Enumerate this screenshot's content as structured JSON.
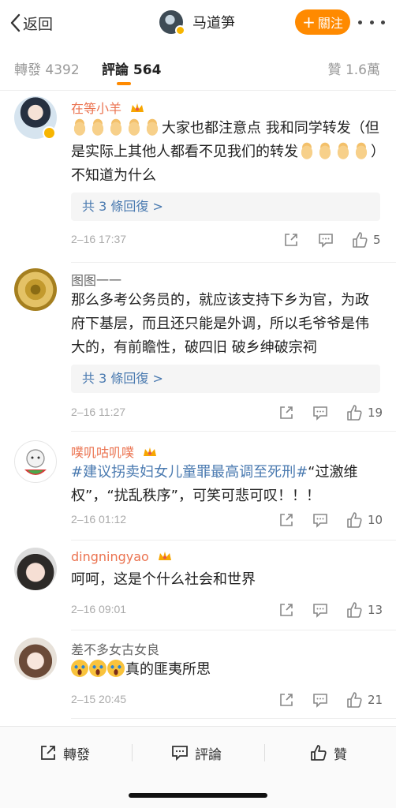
{
  "topbar": {
    "back_label": "返回",
    "author_name": "马道笋",
    "follow_label": "關注",
    "follow_plus": "+"
  },
  "tabs": {
    "repost": "轉發 4392",
    "comments": "評論 564",
    "likes": "贊 1.6萬"
  },
  "comments": [
    {
      "user": "在等小羊",
      "text_parts": [
        "大家也都注意点 我和同学转发（但是实际上其他人都看不见我们的转发",
        "）不知道为什么"
      ],
      "replies": "共 3 條回復 >",
      "time": "2–16 17:37",
      "likes": "5"
    },
    {
      "user": "图图一一",
      "text": "那么多考公务员的，就应该支持下乡为官，为政府下基层，而且还只能是外调，所以毛爷爷是伟大的，有前瞻性，破四旧 破乡绅破宗祠",
      "replies": "共 3 條回復 >",
      "time": "2–16 11:27",
      "likes": "19"
    },
    {
      "user": "噗叽咕叽噗",
      "hashtag": "#建议拐卖妇女儿童罪最高调至死刑#",
      "text": "“过激维权”，“扰乱秩序”，可笑可悲可叹！！！",
      "time": "2–16 01:12",
      "likes": "10"
    },
    {
      "user": "dingningyao",
      "text": "呵呵，这是个什么社会和世界",
      "time": "2–16 09:01",
      "likes": "13"
    },
    {
      "user": "差不多女古女良",
      "text": "真的匪夷所思",
      "time": "2–15 20:45",
      "likes": "21"
    }
  ],
  "bottom_bar": {
    "repost": "轉發",
    "comment": "評論",
    "like": "贊"
  },
  "colors": {
    "accent": "#ff8a00",
    "username_orange": "#eb7350",
    "link_blue": "#4a7ab0"
  },
  "icons": [
    "chevron-left-icon",
    "more-icon",
    "crown-icon",
    "verified-icon",
    "pray-emoji",
    "crying-emoji",
    "share-icon",
    "comment-icon",
    "thumbs-up-icon"
  ]
}
